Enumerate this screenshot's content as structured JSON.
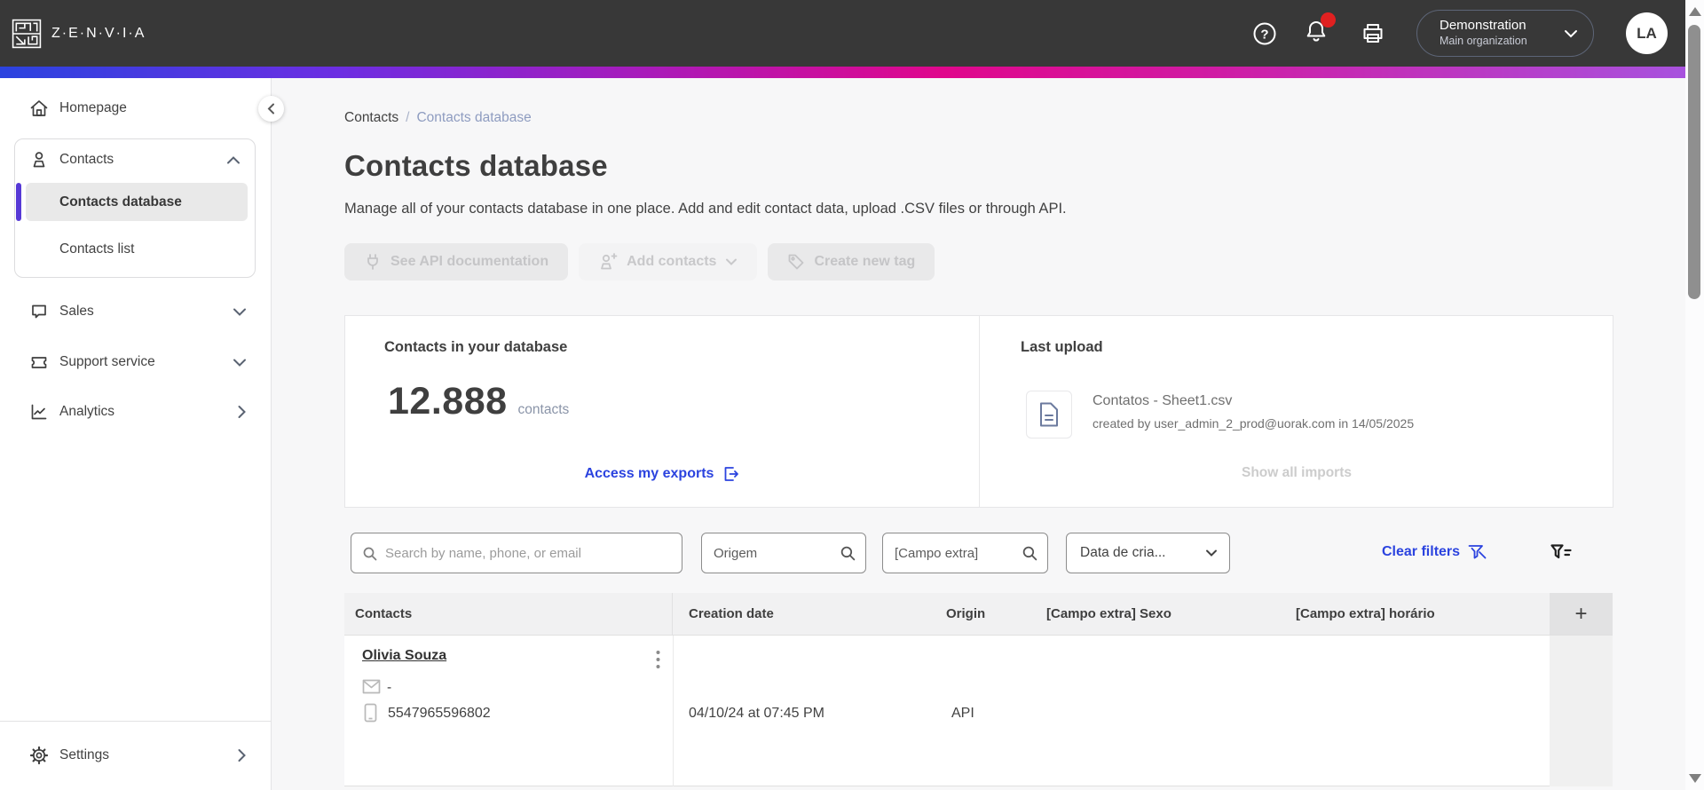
{
  "topbar": {
    "brand": "Z·E·N·V·I·A",
    "org": {
      "name": "Demonstration",
      "sub": "Main organization"
    },
    "avatar_initials": "LA"
  },
  "sidebar": {
    "homepage": "Homepage",
    "contacts": "Contacts",
    "contacts_database": "Contacts database",
    "contacts_list": "Contacts list",
    "sales": "Sales",
    "support": "Support service",
    "analytics": "Analytics",
    "settings": "Settings"
  },
  "breadcrumb": {
    "parent": "Contacts",
    "separator": "/",
    "current": "Contacts database"
  },
  "header": {
    "title": "Contacts database",
    "description": "Manage all of your contacts database in one place. Add and edit contact data, upload .CSV files or through API."
  },
  "actions": {
    "see_api": "See API documentation",
    "add_contacts": "Add contacts",
    "create_tag": "Create new tag"
  },
  "stats": {
    "contacts_card": {
      "title": "Contacts in your database",
      "count": "12.888",
      "unit": "contacts",
      "exports_link": "Access my exports"
    },
    "last_upload": {
      "title": "Last upload",
      "file_name": "Contatos - Sheet1.csv",
      "meta": "created by user_admin_2_prod@uorak.com in 14/05/2025",
      "show_all": "Show all imports"
    }
  },
  "filters": {
    "search_placeholder": "Search by name, phone, or email",
    "origem_placeholder": "Origem",
    "campo_extra_placeholder": "[Campo extra]",
    "date_label": "Data de cria...",
    "clear_label": "Clear filters"
  },
  "table": {
    "columns": [
      "Contacts",
      "Creation date",
      "Origin",
      "[Campo extra] Sexo",
      "[Campo extra] horário"
    ],
    "add_column": "+",
    "rows": [
      {
        "name": "Olivia Souza",
        "email": "-",
        "phone": "5547965596802",
        "creation_date": "04/10/24 at 07:45 PM",
        "origin": "API",
        "sexo": "",
        "horario": ""
      }
    ]
  },
  "colors": {
    "topbar_bg": "#383838",
    "accent_blue": "#2b43df",
    "active_indicator_purple": "#5639d6",
    "notification_red": "#e02020",
    "gradient_left": "#2b43df",
    "gradient_mid": "#e0078c",
    "gradient_right": "#a852de"
  }
}
